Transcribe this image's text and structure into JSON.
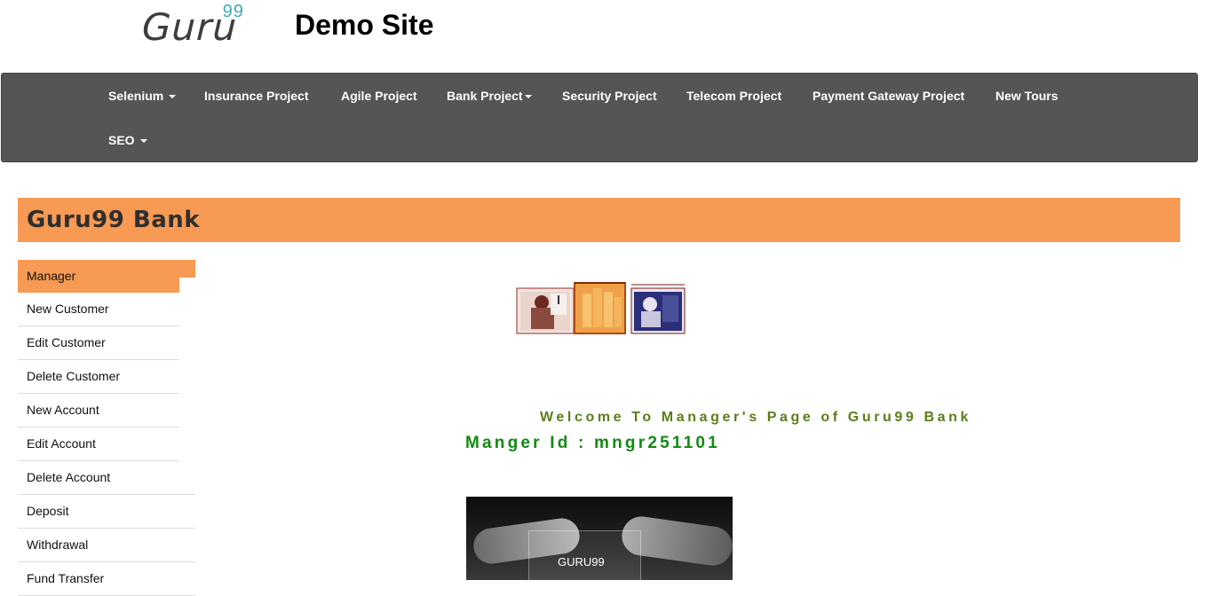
{
  "header": {
    "logo_text": "Guru",
    "logo_sup": "99",
    "site_title": "Demo Site"
  },
  "navbar": {
    "items": [
      {
        "label": "Selenium",
        "dropdown": true
      },
      {
        "label": "Insurance Project",
        "dropdown": false
      },
      {
        "label": "Agile Project",
        "dropdown": false
      },
      {
        "label": "Bank Project",
        "dropdown": true
      },
      {
        "label": "Security Project",
        "dropdown": false
      },
      {
        "label": "Telecom Project",
        "dropdown": false
      },
      {
        "label": "Payment Gateway Project",
        "dropdown": false
      },
      {
        "label": "New Tours",
        "dropdown": false
      },
      {
        "label": "SEO",
        "dropdown": true
      }
    ]
  },
  "bank": {
    "title": "Guru99 Bank"
  },
  "sidebar": {
    "items": [
      {
        "label": "Manager"
      },
      {
        "label": "New Customer"
      },
      {
        "label": "Edit Customer"
      },
      {
        "label": "Delete Customer"
      },
      {
        "label": "New Account"
      },
      {
        "label": "Edit Account"
      },
      {
        "label": "Delete Account"
      },
      {
        "label": "Deposit"
      },
      {
        "label": "Withdrawal"
      },
      {
        "label": "Fund Transfer"
      }
    ]
  },
  "main": {
    "welcome": "Welcome To Manager's Page of Guru99 Bank",
    "manager_id": "Manger Id : mngr251101",
    "photo_card_text": "GURU99"
  },
  "colors": {
    "navbar_bg": "#555555",
    "accent_orange": "#f79a53",
    "welcome_green": "#5b7e1a",
    "manager_id_green": "#138a13",
    "logo_sup_teal": "#3aa9b8"
  }
}
